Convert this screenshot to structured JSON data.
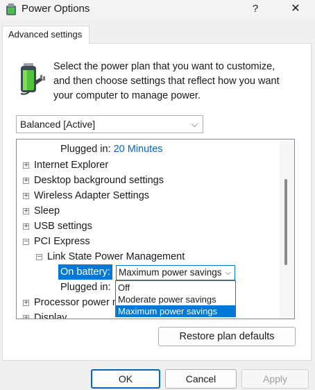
{
  "window": {
    "title": "Power Options",
    "help_glyph": "?",
    "close_glyph": "✕"
  },
  "tab": {
    "label": "Advanced settings"
  },
  "description": {
    "lines": [
      "Select the power plan that you want to customize,",
      "and then choose settings that reflect how you want",
      "your computer to manage power."
    ]
  },
  "plan_select": {
    "value": "Balanced [Active]",
    "chevron": "⌵"
  },
  "tree": {
    "plugged_in_top": {
      "label": "Plugged in:",
      "value": "20 Minutes"
    },
    "items": {
      "internet_explorer": "Internet Explorer",
      "desktop_background": "Desktop background settings",
      "wireless_adapter": "Wireless Adapter Settings",
      "sleep": "Sleep",
      "usb": "USB settings",
      "pci_express": "PCI Express",
      "link_state": "Link State Power Management",
      "processor_power": "Processor power m",
      "display": "Display"
    },
    "on_battery": {
      "label": "On battery:",
      "value": "Maximum power savings"
    },
    "plugged_in": {
      "label": "Plugged in:"
    },
    "expand_glyph": "+",
    "collapse_glyph": "−"
  },
  "dropdown_options": [
    "Off",
    "Moderate power savings",
    "Maximum power savings"
  ],
  "dropdown_selected_index": 2,
  "buttons": {
    "restore": "Restore plan defaults",
    "ok": "OK",
    "cancel": "Cancel",
    "apply": "Apply"
  },
  "colors": {
    "selection": "#0078d7",
    "link": "#0066cc",
    "ok_border": "#0067c0"
  },
  "icons": [
    "power-options-icon",
    "battery-plug-icon"
  ]
}
